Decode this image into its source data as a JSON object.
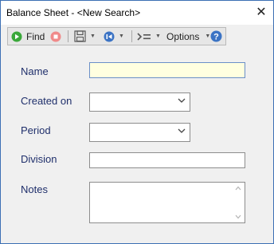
{
  "window": {
    "title": "Balance Sheet - <New Search>",
    "close_glyph": "✕"
  },
  "toolbar": {
    "find_label": "Find",
    "options_label": "Options",
    "icons": [
      "find-play-icon",
      "stop-icon",
      "save-icon",
      "back-icon",
      "list-icon",
      "help-icon"
    ]
  },
  "form": {
    "name_label": "Name",
    "name_value": "",
    "created_on_label": "Created on",
    "created_on_value": "",
    "period_label": "Period",
    "period_value": "",
    "division_label": "Division",
    "division_value": "",
    "notes_label": "Notes",
    "notes_value": ""
  },
  "colors": {
    "label": "#1f2f6b",
    "name_field_bg": "#ffffe0",
    "name_field_border": "#6a8fc8",
    "find_icon": "#3aa83a",
    "stop_icon": "#f08a8a",
    "help_icon": "#3b73c4",
    "back_icon": "#3b73c4"
  }
}
